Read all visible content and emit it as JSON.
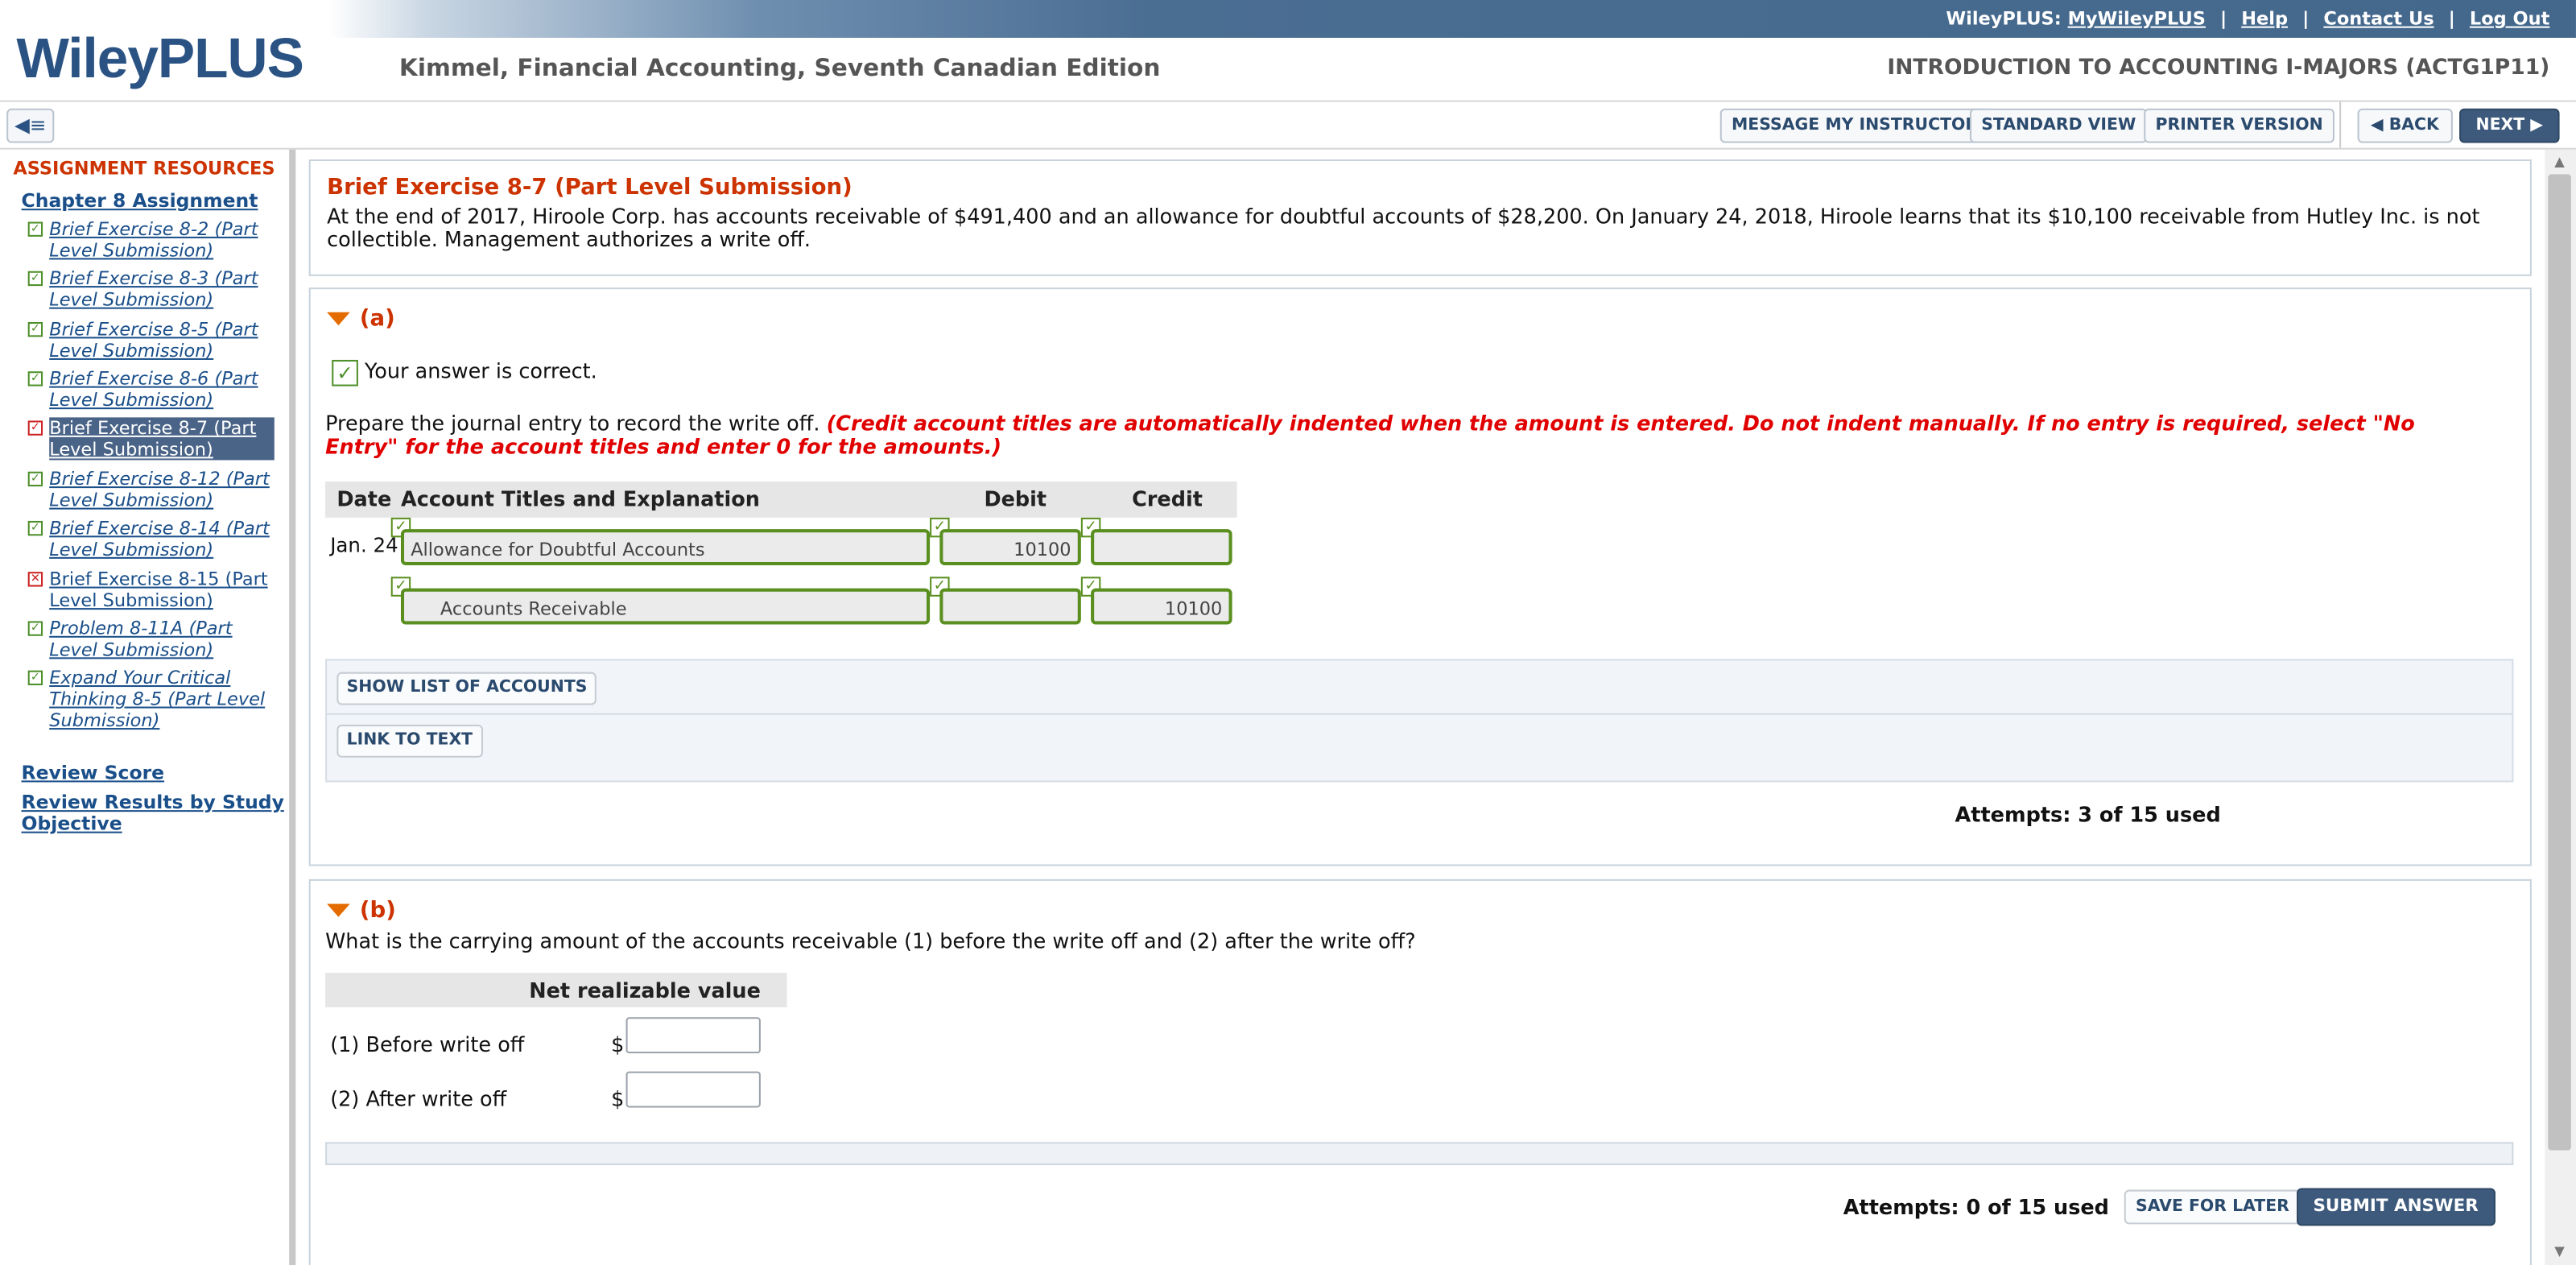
{
  "header": {
    "logo_text": "WileyPLUS",
    "book_title": "Kimmel, Financial Accounting, Seventh Canadian Edition",
    "course_title": "INTRODUCTION TO ACCOUNTING I-MAJORS (ACTG1P11)",
    "links": {
      "prefix": "WileyPLUS:",
      "my": "MyWileyPLUS",
      "help": "Help",
      "contact": "Contact Us",
      "logout": "Log Out",
      "separator": "|"
    }
  },
  "toolbar": {
    "sidebar_toggle_icon": "sidebar-collapse-icon",
    "message_instructor": "MESSAGE MY INSTRUCTOR",
    "standard_view": "STANDARD VIEW",
    "printer_version": "PRINTER VERSION",
    "back": "BACK",
    "next": "NEXT",
    "back_icon": "caret-left-icon",
    "next_icon": "caret-right-icon"
  },
  "sidebar": {
    "resources_title": "ASSIGNMENT RESOURCES",
    "chapter_title": "Chapter 8 Assignment",
    "items": [
      {
        "label": "Brief Exercise 8-2 (Part Level Submission)",
        "status": "check"
      },
      {
        "label": "Brief Exercise 8-3 (Part Level Submission)",
        "status": "check"
      },
      {
        "label": "Brief Exercise 8-5 (Part Level Submission)",
        "status": "check"
      },
      {
        "label": "Brief Exercise 8-6 (Part Level Submission)",
        "status": "check"
      },
      {
        "label": "Brief Exercise 8-7 (Part Level Submission)",
        "status": "check",
        "selected": true
      },
      {
        "label": "Brief Exercise 8-12 (Part Level Submission)",
        "status": "check"
      },
      {
        "label": "Brief Exercise 8-14 (Part Level Submission)",
        "status": "check"
      },
      {
        "label": "Brief Exercise 8-15 (Part Level Submission)",
        "status": "x"
      },
      {
        "label": "Problem 8-11A (Part Level Submission)",
        "status": "check"
      },
      {
        "label": "Expand Your Critical Thinking 8-5 (Part Level Submission)",
        "status": "check"
      }
    ],
    "review_score": "Review Score",
    "review_results": "Review Results by Study Objective"
  },
  "exercise": {
    "title": "Brief Exercise 8-7 (Part Level Submission)",
    "text": "At the end of 2017, Hiroole Corp. has accounts receivable of $491,400 and an allowance for doubtful accounts of $28,200. On January 24, 2018, Hiroole learns that its $10,100 receivable from Hutley Inc. is not collectible. Management authorizes a write off."
  },
  "part_a": {
    "label": "(a)",
    "feedback": "Your answer is correct.",
    "prompt": "Prepare the journal entry to record the write off.",
    "instructions": "(Credit account titles are automatically indented when the amount is entered. Do not indent manually. If no entry is required, select \"No Entry\" for the account titles and enter 0 for the amounts.)",
    "table_headers": {
      "date": "Date",
      "account": "Account Titles and Explanation",
      "debit": "Debit",
      "credit": "Credit"
    },
    "rows": [
      {
        "date": "Jan. 24",
        "account": "Allowance for Doubtful Accounts",
        "debit": "10100",
        "credit": ""
      },
      {
        "date": "",
        "account": "Accounts Receivable",
        "debit": "",
        "credit": "10100"
      }
    ],
    "show_accounts_button": "SHOW LIST OF ACCOUNTS",
    "link_to_text_button": "LINK TO TEXT",
    "attempts": "Attempts: 3 of 15 used"
  },
  "part_b": {
    "label": "(b)",
    "question": "What is the carrying amount of the accounts receivable (1) before the write off and (2) after the write off?",
    "column_header": "Net realizable value",
    "rows": [
      {
        "label": "(1) Before write off",
        "currency": "$",
        "value": ""
      },
      {
        "label": "(2) After write off",
        "currency": "$",
        "value": ""
      }
    ],
    "attempts": "Attempts: 0 of 15 used",
    "save_for_later": "SAVE FOR LATER",
    "submit_answer": "SUBMIT ANSWER"
  }
}
